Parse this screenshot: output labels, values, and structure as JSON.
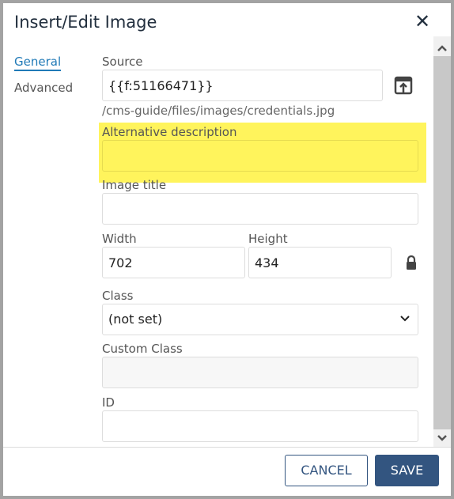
{
  "dialog": {
    "title": "Insert/Edit Image",
    "close_icon": "close-icon"
  },
  "tabs": [
    {
      "label": "General",
      "active": true
    },
    {
      "label": "Advanced",
      "active": false
    }
  ],
  "fields": {
    "source": {
      "label": "Source",
      "value": "{{f:51166471}}",
      "path": "/cms-guide/files/images/credentials.jpg"
    },
    "alt": {
      "label": "Alternative description",
      "value": ""
    },
    "title": {
      "label": "Image title",
      "value": ""
    },
    "width": {
      "label": "Width",
      "value": "702"
    },
    "height": {
      "label": "Height",
      "value": "434"
    },
    "class": {
      "label": "Class",
      "value": "(not set)"
    },
    "custom_class": {
      "label": "Custom Class",
      "value": ""
    },
    "id": {
      "label": "ID",
      "value": ""
    }
  },
  "buttons": {
    "cancel": "CANCEL",
    "save": "SAVE"
  },
  "colors": {
    "accent": "#335580",
    "highlight": "#fff45c",
    "tab_active": "#207ab7"
  }
}
